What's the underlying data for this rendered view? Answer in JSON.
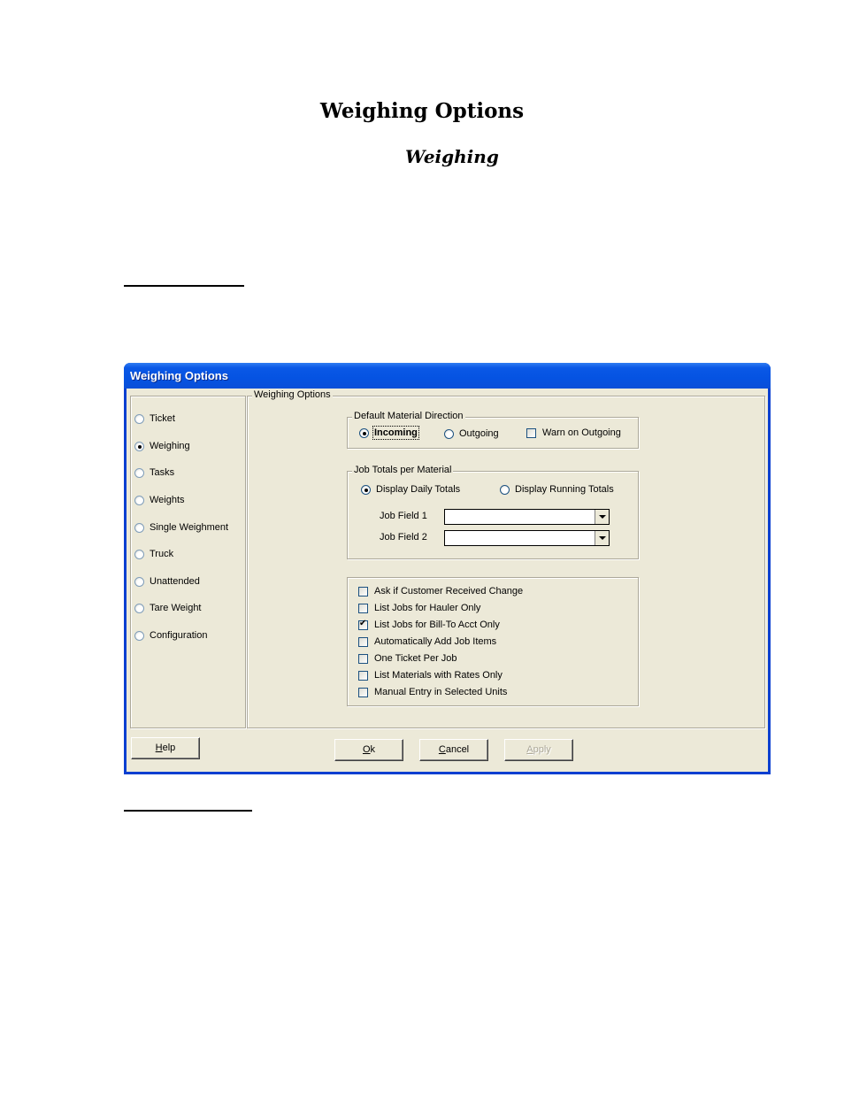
{
  "document": {
    "title": "Weighing Options",
    "subtitle": "Weighing"
  },
  "dialog": {
    "title": "Weighing Options",
    "sidebar": {
      "items": [
        {
          "label": "Ticket",
          "selected": false
        },
        {
          "label": "Weighing",
          "selected": true
        },
        {
          "label": "Tasks",
          "selected": false
        },
        {
          "label": "Weights",
          "selected": false
        },
        {
          "label": "Single Weighment",
          "selected": false
        },
        {
          "label": "Truck",
          "selected": false
        },
        {
          "label": "Unattended",
          "selected": false
        },
        {
          "label": "Tare Weight",
          "selected": false
        },
        {
          "label": "Configuration",
          "selected": false
        }
      ]
    },
    "main_group_label": "Weighing Options",
    "direction_group": {
      "label": "Default Material Direction",
      "incoming": "Incoming",
      "outgoing": "Outgoing",
      "warn_on_outgoing": "Warn on Outgoing",
      "selected": "Incoming",
      "warn_checked": false
    },
    "job_totals_group": {
      "label": "Job Totals per Material",
      "daily": "Display Daily Totals",
      "running": "Display Running Totals",
      "selected": "Display Daily Totals",
      "job_field_1_label": "Job Field 1",
      "job_field_1_value": "",
      "job_field_2_label": "Job Field 2",
      "job_field_2_value": ""
    },
    "checkboxes": [
      {
        "label": "Ask if Customer Received Change",
        "checked": false
      },
      {
        "label": "List Jobs for Hauler Only",
        "checked": false
      },
      {
        "label": "List Jobs for Bill-To Acct Only",
        "checked": true
      },
      {
        "label": "Automatically Add Job Items",
        "checked": false
      },
      {
        "label": "One Ticket Per Job",
        "checked": false
      },
      {
        "label": "List Materials with Rates Only",
        "checked": false
      },
      {
        "label": "Manual Entry in Selected Units",
        "checked": false
      }
    ],
    "buttons": {
      "help": {
        "hotkey": "H",
        "rest": "elp"
      },
      "ok": {
        "hotkey": "O",
        "rest": "k"
      },
      "cancel": {
        "hotkey": "C",
        "rest": "ancel"
      },
      "apply": {
        "hotkey": "A",
        "rest": "pply",
        "disabled": true
      }
    }
  }
}
